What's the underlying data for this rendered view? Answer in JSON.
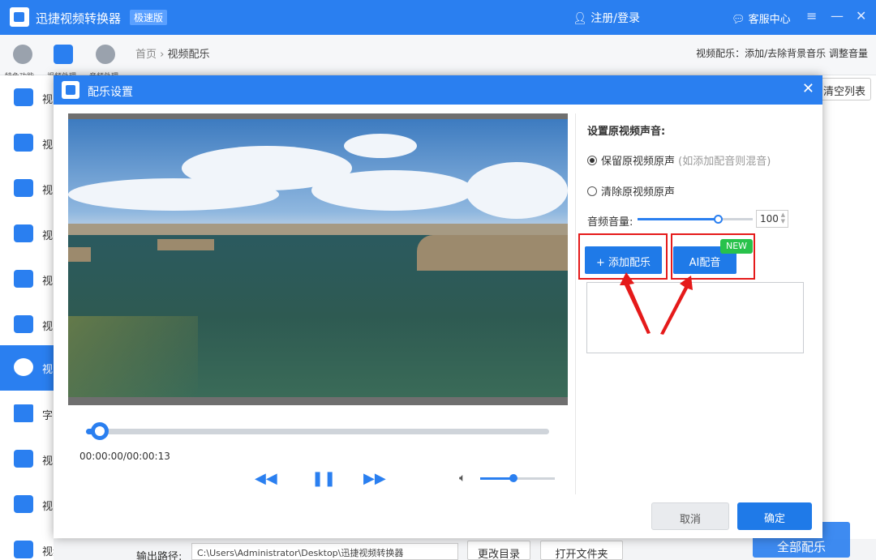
{
  "app": {
    "title": "迅捷视频转换器",
    "edition": "极速版",
    "login_label": "注册/登录",
    "service_label": "客服中心",
    "win_menu": "≡",
    "win_minimize": "—",
    "win_close": "✕"
  },
  "topnav": {
    "categories": [
      {
        "label": "特色功能",
        "icon": "star-icon"
      },
      {
        "label": "视频处理",
        "icon": "video-process-icon"
      },
      {
        "label": "音频处理",
        "icon": "audio-process-icon"
      }
    ],
    "breadcrumb": {
      "home": "首页",
      "separator": "›",
      "current": "视频配乐"
    },
    "hint": "视频配乐：添加/去除背景音乐 调整音量"
  },
  "sidebar": {
    "items": [
      {
        "label": "视",
        "icon": "video-convert-icon"
      },
      {
        "label": "视",
        "icon": "video-audio-icon"
      },
      {
        "label": "视",
        "icon": "video-split-icon"
      },
      {
        "label": "视",
        "icon": "video-merge-icon"
      },
      {
        "label": "视",
        "icon": "gif-icon"
      },
      {
        "label": "视",
        "icon": "video-watermark-icon"
      },
      {
        "label": "视",
        "icon": "video-music-icon",
        "active": true
      },
      {
        "label": "字",
        "icon": "subtitle-icon"
      },
      {
        "label": "视",
        "icon": "crop-icon"
      },
      {
        "label": "视",
        "icon": "video-frame-icon"
      },
      {
        "label": "视频倒放",
        "icon": "video-reverse-icon"
      }
    ]
  },
  "main": {
    "clear_list": "清空列表",
    "output_label": "输出路径:",
    "output_path": "C:\\Users\\Administrator\\Desktop\\迅捷视频转换器",
    "change_dir": "更改目录",
    "open_folder": "打开文件夹",
    "process_all": "全部配乐"
  },
  "dialog": {
    "title": "配乐设置",
    "close": "✕",
    "player": {
      "timecode": "00:00:00/00:00:13",
      "progress": 0.03,
      "volume": 0.45
    },
    "settings": {
      "title": "设置原视频声音:",
      "options": [
        {
          "label": "保留原视频原声",
          "note": "(如添加配音则混音)",
          "selected": true
        },
        {
          "label": "清除原视频原声",
          "note": "",
          "selected": false
        }
      ],
      "volume_label": "音频音量:",
      "volume_value": "100",
      "volume_fraction": 0.7
    },
    "add_music": "+ 添加配乐",
    "ai_dub": "AI配音",
    "new_badge": "NEW",
    "cancel": "取消",
    "confirm": "确定"
  },
  "colors": {
    "accent": "#2a7ff0",
    "button": "#1f7ae8",
    "badge": "#28c24b",
    "highlight": "#e51a1a"
  }
}
